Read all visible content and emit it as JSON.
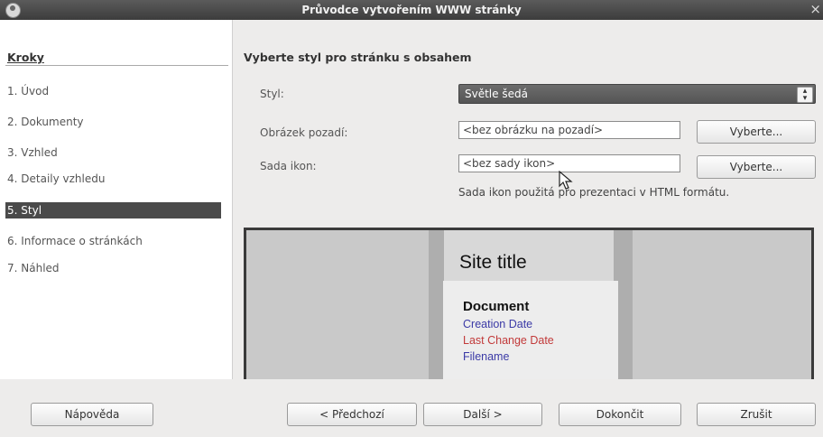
{
  "window": {
    "title": "Průvodce vytvořením WWW stránky",
    "close_glyph": "×"
  },
  "sidebar": {
    "heading": "Kroky",
    "steps": [
      "1. Úvod",
      "2. Dokumenty",
      "3. Vzhled",
      "4. Detaily vzhledu",
      "5. Styl",
      "6. Informace o stránkách",
      "7. Náhled"
    ],
    "active_step": "5. Styl"
  },
  "main": {
    "heading": "Vyberte styl pro stránku s obsahem",
    "style_label": "Styl:",
    "style_value": "Světle šedá",
    "background_label": "Obrázek pozadí:",
    "background_value": "<bez obrázku na pozadí>",
    "background_button": "Vyberte...",
    "iconset_label": "Sada ikon:",
    "iconset_value": "<bez sady ikon>",
    "iconset_button": "Vyberte...",
    "iconset_hint": "Sada ikon použitá pro prezentaci v HTML formátu."
  },
  "preview": {
    "site_title": "Site title",
    "document": "Document",
    "creation_date": "Creation Date",
    "last_change_date": "Last Change Date",
    "filename": "Filename",
    "colors": {
      "meta_blue": "#3b3aa6",
      "meta_red": "#c23a3a"
    }
  },
  "footer": {
    "help": "Nápověda",
    "prev": "< Předchozí",
    "next": "Další >",
    "finish": "Dokončit",
    "cancel": "Zrušit"
  },
  "colors": {
    "titlebar": "#4a4a4a",
    "active_step_bg": "#4a4a4a",
    "combo_bg": "#5e5e5e"
  }
}
